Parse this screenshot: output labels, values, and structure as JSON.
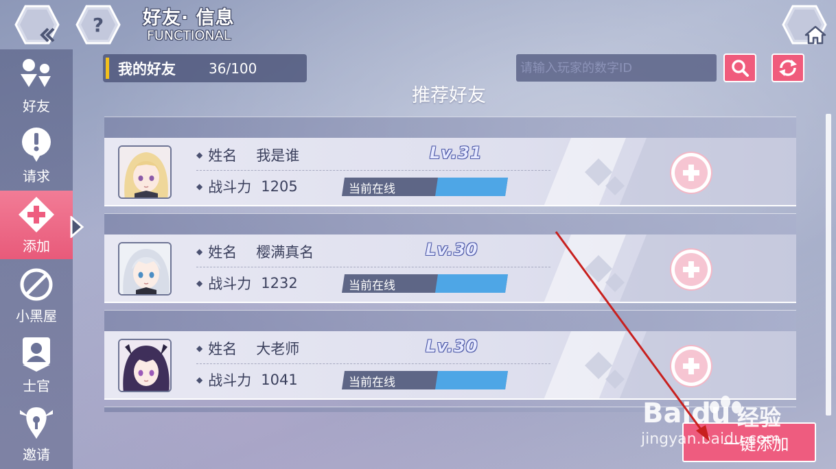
{
  "header": {
    "title_cn": "好友· 信息",
    "title_en": "FUNCTIONAL",
    "back_icon": "back-chevron-icon",
    "help_glyph": "?",
    "home_icon": "home-icon"
  },
  "sidebar": {
    "items": [
      {
        "label": "好友",
        "icon": "friends-icon"
      },
      {
        "label": "请求",
        "icon": "exclamation-icon"
      },
      {
        "label": "添加",
        "icon": "add-icon",
        "active": true
      },
      {
        "label": "小黑屋",
        "icon": "block-icon"
      },
      {
        "label": "士官",
        "icon": "officer-icon"
      },
      {
        "label": "邀请",
        "icon": "invite-icon"
      }
    ]
  },
  "friends_summary": {
    "label": "我的好友",
    "count": "36/100"
  },
  "search": {
    "placeholder": "请输入玩家的数字ID"
  },
  "section_title": "推荐好友",
  "field_labels": {
    "name": "姓名",
    "power": "战斗力",
    "online": "当前在线"
  },
  "players": [
    {
      "name": "我是谁",
      "power": "1205",
      "level": "Lv.31",
      "status": "当前在线"
    },
    {
      "name": "樱满真名",
      "power": "1232",
      "level": "Lv.30",
      "status": "当前在线"
    },
    {
      "name": "大老师",
      "power": "1041",
      "level": "Lv.30",
      "status": "当前在线"
    }
  ],
  "add_all_button": "一键添加",
  "watermark": {
    "brand": "Bai",
    "brand2": "du",
    "cn": "经验",
    "url": "jingyan.baidu.com"
  },
  "colors": {
    "accent": "#ee5c7f",
    "sidebar": "#5f678c",
    "online_bar": "#4ea6e6",
    "level_text": "#4a56a6"
  }
}
